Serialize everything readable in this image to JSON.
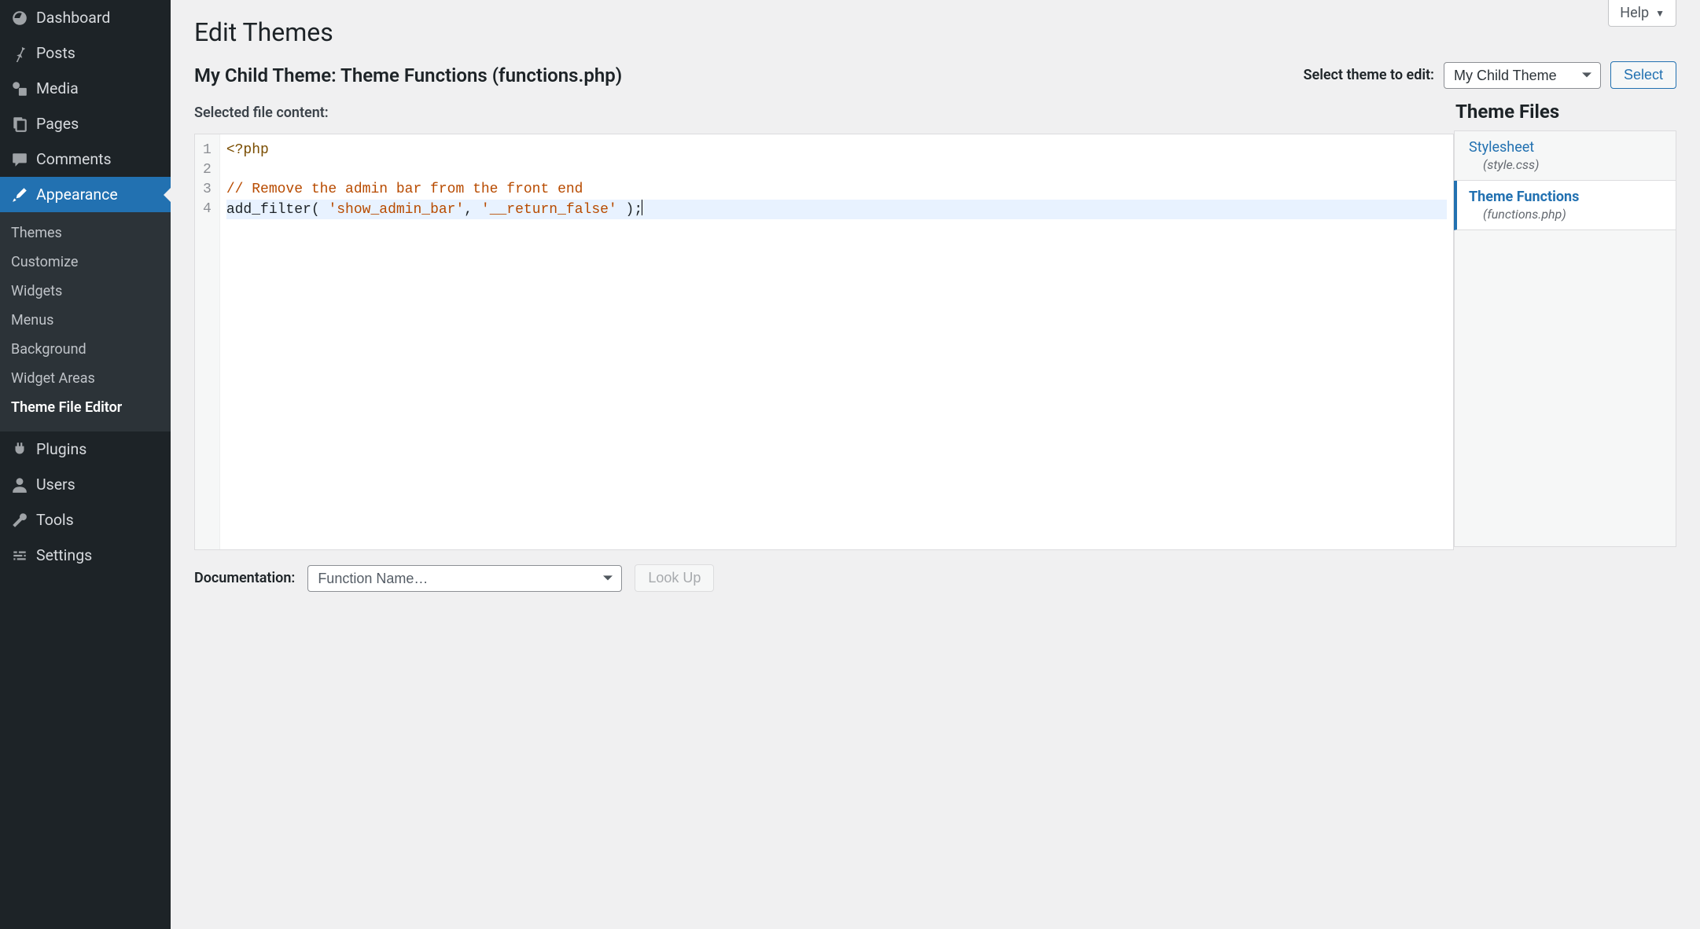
{
  "sidebar": {
    "items": [
      {
        "label": "Dashboard",
        "icon": "dashboard-icon"
      },
      {
        "label": "Posts",
        "icon": "pin-icon"
      },
      {
        "label": "Media",
        "icon": "media-icon"
      },
      {
        "label": "Pages",
        "icon": "pages-icon"
      },
      {
        "label": "Comments",
        "icon": "comment-icon"
      },
      {
        "label": "Appearance",
        "icon": "brush-icon",
        "active": true
      },
      {
        "label": "Plugins",
        "icon": "plug-icon"
      },
      {
        "label": "Users",
        "icon": "user-icon"
      },
      {
        "label": "Tools",
        "icon": "wrench-icon"
      },
      {
        "label": "Settings",
        "icon": "sliders-icon"
      }
    ],
    "submenu": [
      "Themes",
      "Customize",
      "Widgets",
      "Menus",
      "Background",
      "Widget Areas",
      "Theme File Editor"
    ],
    "submenu_current_index": 6
  },
  "help_label": "Help",
  "page_title": "Edit Themes",
  "editing_heading": "My Child Theme: Theme Functions (functions.php)",
  "theme_select": {
    "label": "Select theme to edit:",
    "selected": "My Child Theme",
    "button": "Select"
  },
  "selected_file_label": "Selected file content:",
  "code": {
    "lines": [
      "<?php",
      "",
      "// Remove the admin bar from the front end",
      "add_filter( 'show_admin_bar', '__return_false' );"
    ],
    "active_line_index": 3
  },
  "theme_files": {
    "heading": "Theme Files",
    "items": [
      {
        "name": "Stylesheet",
        "path": "(style.css)",
        "current": false
      },
      {
        "name": "Theme Functions",
        "path": "(functions.php)",
        "current": true
      }
    ]
  },
  "documentation": {
    "label": "Documentation:",
    "select_placeholder": "Function Name…",
    "button": "Look Up"
  }
}
